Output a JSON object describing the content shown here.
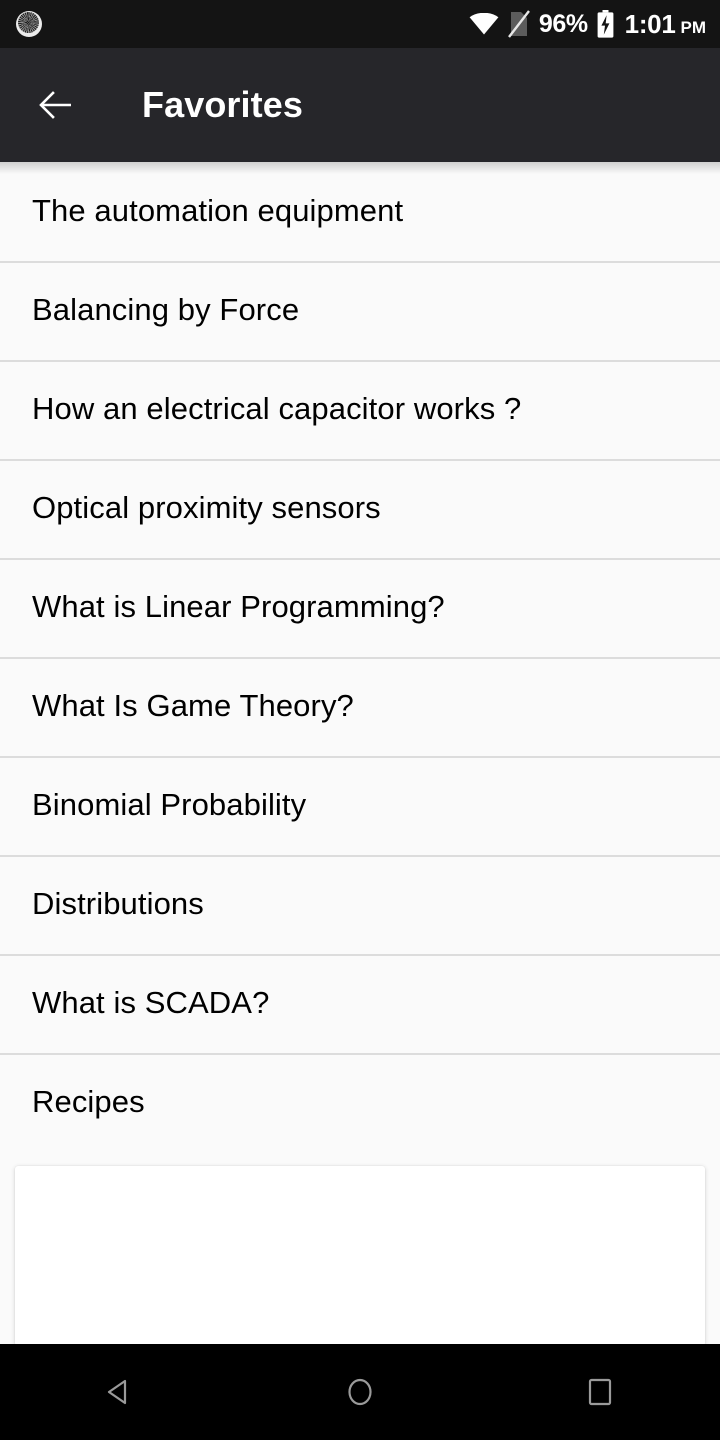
{
  "status_bar": {
    "notification_icon": "progress-clock-icon",
    "wifi_icon": "wifi-full-icon",
    "sim_icon": "no-sim-card-icon",
    "battery_percent": "96%",
    "battery_icon": "battery-charging-icon",
    "time": "1:01",
    "meridiem": "PM",
    "background_color": "#141414",
    "text_color": "#ffffff"
  },
  "toolbar": {
    "back_icon": "arrow-left-icon",
    "title": "Favorites",
    "background_color": "#26262a",
    "title_color": "#ffffff"
  },
  "list": {
    "background_color": "#fafafa",
    "divider_color": "#dcdcdc",
    "text_color": "#000000",
    "items": [
      {
        "label": "The automation equipment"
      },
      {
        "label": "Balancing by Force"
      },
      {
        "label": "How an electrical capacitor works ?"
      },
      {
        "label": "Optical proximity sensors"
      },
      {
        "label": "What is Linear Programming?"
      },
      {
        "label": "What Is Game Theory?"
      },
      {
        "label": "Binomial Probability"
      },
      {
        "label": "Distributions"
      },
      {
        "label": "What is SCADA?"
      },
      {
        "label": "Recipes"
      }
    ]
  },
  "ad_card": {
    "content": "",
    "background_color": "#ffffff"
  },
  "navigation_bar": {
    "background_color": "#000000",
    "icon_color": "#9a9a9a",
    "back_icon": "nav-back-triangle-icon",
    "home_icon": "nav-home-circle-icon",
    "recents_icon": "nav-recents-square-icon"
  }
}
